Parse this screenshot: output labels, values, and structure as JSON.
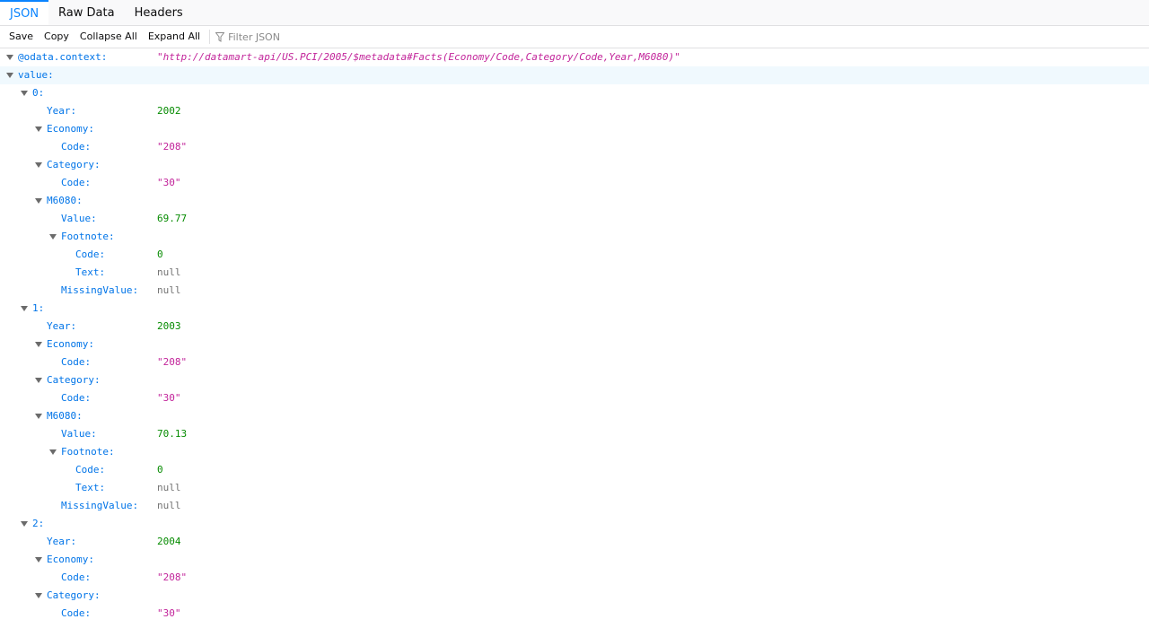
{
  "tabs": [
    {
      "label": "JSON",
      "active": true
    },
    {
      "label": "Raw Data",
      "active": false
    },
    {
      "label": "Headers",
      "active": false
    }
  ],
  "toolbar": {
    "save": "Save",
    "copy": "Copy",
    "collapse_all": "Collapse All",
    "expand_all": "Expand All",
    "filter_placeholder": "Filter JSON",
    "filter_icon": "funnel-icon"
  },
  "colors": {
    "accent": "#0a84ff",
    "key": "#0074e8",
    "string": "#c2249a",
    "number": "#058b00",
    "null": "#737373",
    "highlight_row": "#f0f9fe"
  },
  "rows": [
    {
      "depth": 0,
      "key": "@odata.context:",
      "twisty": true,
      "value": "\"http://datamart-api/US.PCI/2005/$metadata#Facts(Economy/Code,Category/Code,Year,M6080)\"",
      "type": "url"
    },
    {
      "depth": 0,
      "key": "value:",
      "twisty": true,
      "value": "",
      "type": "",
      "highlight": true
    },
    {
      "depth": 1,
      "key": "0:",
      "twisty": true,
      "value": "",
      "type": ""
    },
    {
      "depth": 2,
      "key": "Year:",
      "twisty": false,
      "value": "2002",
      "type": "num"
    },
    {
      "depth": 2,
      "key": "Economy:",
      "twisty": true,
      "value": "",
      "type": ""
    },
    {
      "depth": 3,
      "key": "Code:",
      "twisty": false,
      "value": "\"208\"",
      "type": "str"
    },
    {
      "depth": 2,
      "key": "Category:",
      "twisty": true,
      "value": "",
      "type": ""
    },
    {
      "depth": 3,
      "key": "Code:",
      "twisty": false,
      "value": "\"30\"",
      "type": "str"
    },
    {
      "depth": 2,
      "key": "M6080:",
      "twisty": true,
      "value": "",
      "type": ""
    },
    {
      "depth": 3,
      "key": "Value:",
      "twisty": false,
      "value": "69.77",
      "type": "num"
    },
    {
      "depth": 3,
      "key": "Footnote:",
      "twisty": true,
      "value": "",
      "type": ""
    },
    {
      "depth": 4,
      "key": "Code:",
      "twisty": false,
      "value": "0",
      "type": "num"
    },
    {
      "depth": 4,
      "key": "Text:",
      "twisty": false,
      "value": "null",
      "type": "nul"
    },
    {
      "depth": 3,
      "key": "MissingValue:",
      "twisty": false,
      "value": "null",
      "type": "nul"
    },
    {
      "depth": 1,
      "key": "1:",
      "twisty": true,
      "value": "",
      "type": ""
    },
    {
      "depth": 2,
      "key": "Year:",
      "twisty": false,
      "value": "2003",
      "type": "num"
    },
    {
      "depth": 2,
      "key": "Economy:",
      "twisty": true,
      "value": "",
      "type": ""
    },
    {
      "depth": 3,
      "key": "Code:",
      "twisty": false,
      "value": "\"208\"",
      "type": "str"
    },
    {
      "depth": 2,
      "key": "Category:",
      "twisty": true,
      "value": "",
      "type": ""
    },
    {
      "depth": 3,
      "key": "Code:",
      "twisty": false,
      "value": "\"30\"",
      "type": "str"
    },
    {
      "depth": 2,
      "key": "M6080:",
      "twisty": true,
      "value": "",
      "type": ""
    },
    {
      "depth": 3,
      "key": "Value:",
      "twisty": false,
      "value": "70.13",
      "type": "num"
    },
    {
      "depth": 3,
      "key": "Footnote:",
      "twisty": true,
      "value": "",
      "type": ""
    },
    {
      "depth": 4,
      "key": "Code:",
      "twisty": false,
      "value": "0",
      "type": "num"
    },
    {
      "depth": 4,
      "key": "Text:",
      "twisty": false,
      "value": "null",
      "type": "nul"
    },
    {
      "depth": 3,
      "key": "MissingValue:",
      "twisty": false,
      "value": "null",
      "type": "nul"
    },
    {
      "depth": 1,
      "key": "2:",
      "twisty": true,
      "value": "",
      "type": ""
    },
    {
      "depth": 2,
      "key": "Year:",
      "twisty": false,
      "value": "2004",
      "type": "num"
    },
    {
      "depth": 2,
      "key": "Economy:",
      "twisty": true,
      "value": "",
      "type": ""
    },
    {
      "depth": 3,
      "key": "Code:",
      "twisty": false,
      "value": "\"208\"",
      "type": "str"
    },
    {
      "depth": 2,
      "key": "Category:",
      "twisty": true,
      "value": "",
      "type": ""
    },
    {
      "depth": 3,
      "key": "Code:",
      "twisty": false,
      "value": "\"30\"",
      "type": "str"
    }
  ]
}
